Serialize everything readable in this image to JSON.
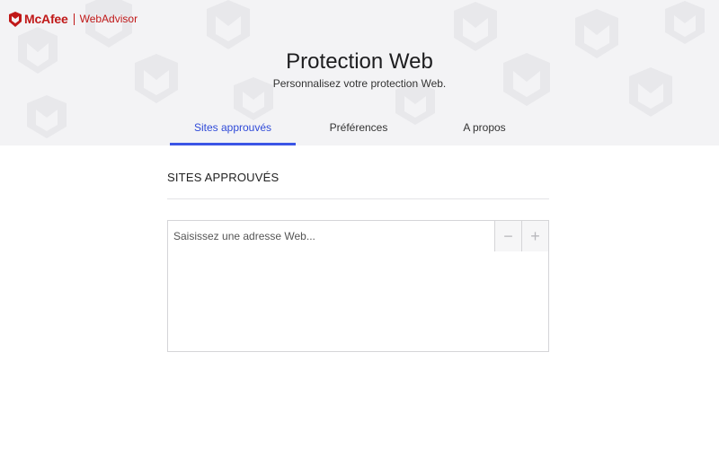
{
  "brand": {
    "name": "McAfee",
    "product": "WebAdvisor",
    "color": "#c01818"
  },
  "header": {
    "title": "Protection Web",
    "subtitle": "Personnalisez votre protection Web."
  },
  "tabs": [
    {
      "label": "Sites approuvés",
      "active": true
    },
    {
      "label": "Préférences",
      "active": false
    },
    {
      "label": "A propos",
      "active": false
    }
  ],
  "accent_color": "#3b55e6",
  "approved_sites": {
    "section_title": "SITES APPROUVÉS",
    "input_placeholder": "Saisissez une adresse Web...",
    "input_value": "",
    "remove_label": "−",
    "add_label": "+",
    "items": []
  }
}
